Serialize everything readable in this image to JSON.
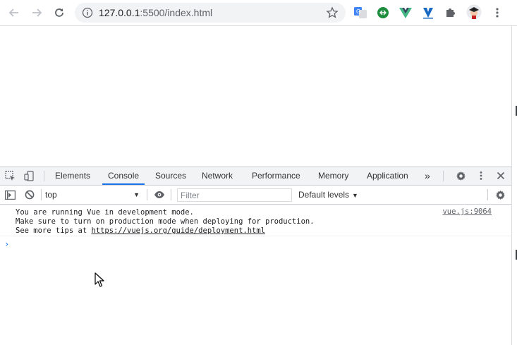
{
  "browser": {
    "url_host": "127.0.0.1",
    "url_rest": ":5500/index.html",
    "extensions": [
      "google-translate-icon",
      "green-circle-extension-icon",
      "vue-devtools-icon",
      "vuetify-icon",
      "puzzle-extensions-icon",
      "profile-avatar"
    ]
  },
  "devtools": {
    "tabs": [
      "Elements",
      "Console",
      "Sources",
      "Network",
      "Performance",
      "Memory",
      "Application"
    ],
    "active_tab": "Console",
    "more_tabs": "»",
    "context": "top",
    "filter_placeholder": "Filter",
    "levels_label": "Default levels"
  },
  "console": {
    "lines": [
      "You are running Vue in development mode.",
      "Make sure to turn on production mode when deploying for production.",
      "See more tips at "
    ],
    "link": "https://vuejs.org/guide/deployment.html",
    "source": "vue.js:9064",
    "prompt": "›"
  },
  "colors": {
    "accent": "#1a73e8",
    "vue_green": "#41b883",
    "vue_dark": "#34495e"
  }
}
